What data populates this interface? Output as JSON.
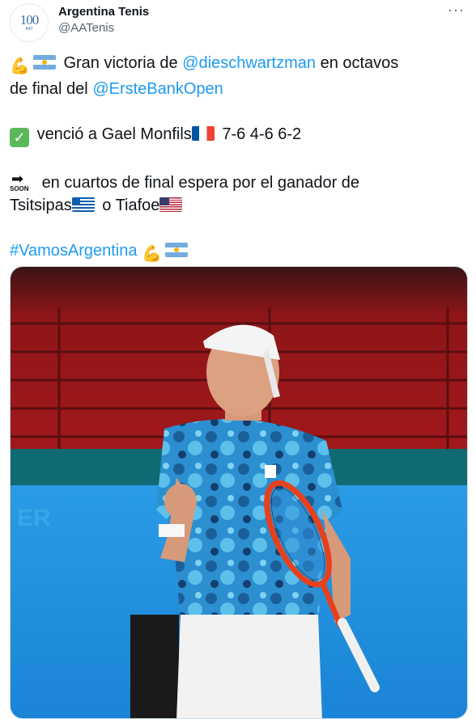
{
  "account": {
    "display_name": "Argentina Tenis",
    "handle": "@AATenis",
    "avatar_text": "100",
    "avatar_subtext": "AAT"
  },
  "menu": {
    "more_label": "···"
  },
  "tweet": {
    "line1_text": "Gran victoria de",
    "mention1": "@dieschwartzman",
    "line1_suffix": "en octavos",
    "line2_prefix": "de final del",
    "mention2": "@ErsteBankOpen",
    "result_text": "venció a Gael Monfils",
    "score": "7-6 4-6 6-2",
    "line4_text": "en cuartos de final espera por el ganador de",
    "line5_a": "Tsitsipas",
    "line5_b": "o Tiafoe",
    "hashtag": "#VamosArgentina"
  },
  "emojis": {
    "flexed_biceps": "💪",
    "check": "✓",
    "soon_arrow": "➡",
    "soon_label": "SOON",
    "flags": [
      "flag-argentina-icon",
      "flag-france-icon",
      "flag-greece-icon",
      "flag-usa-icon"
    ]
  },
  "media": {
    "description_icon": "tennis-player-photo",
    "court_sign": "ER"
  },
  "colors": {
    "link": "#1d9bf0",
    "text": "#0f1419",
    "secondary": "#536471",
    "stands_red": "#a3191c",
    "court_blue": "#1f8fe0",
    "racket_red": "#e8401c"
  }
}
